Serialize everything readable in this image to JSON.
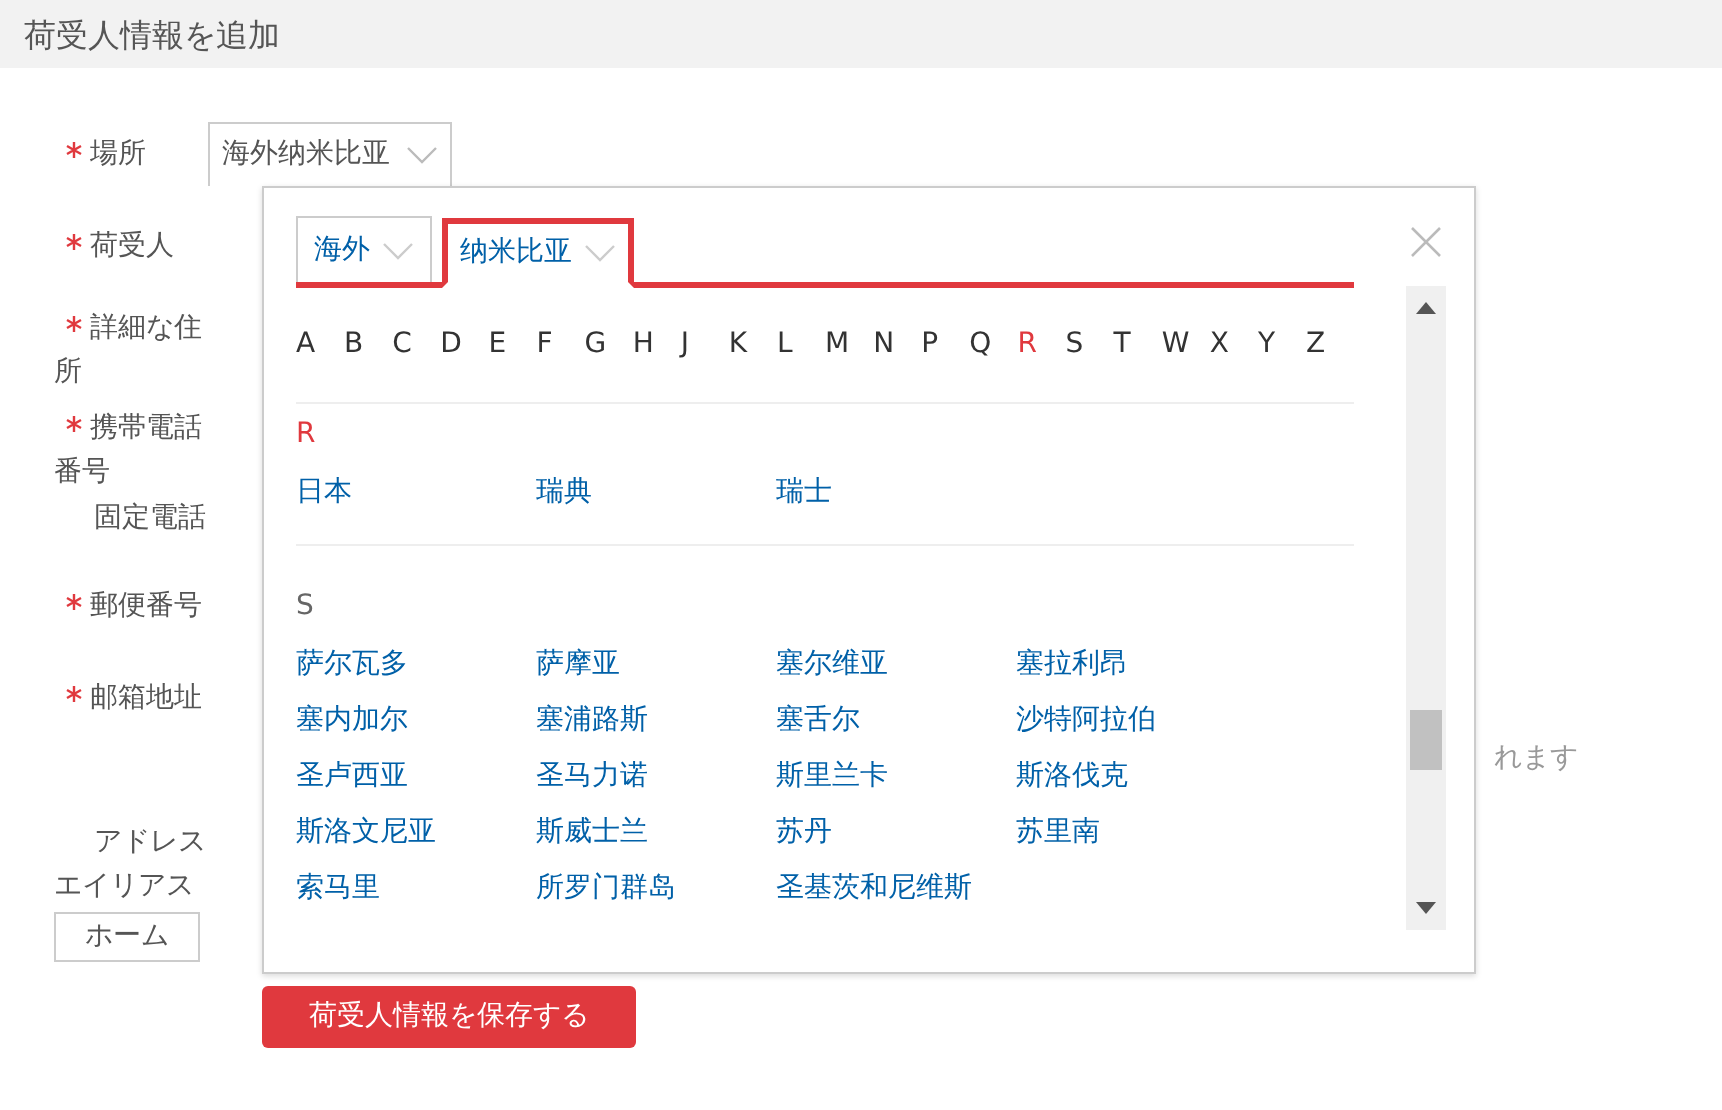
{
  "header": {
    "title": "荷受人情報を追加"
  },
  "fields": [
    {
      "label": "場所",
      "required": true,
      "kind": "select",
      "value": "海外纳米比亚"
    },
    {
      "label": "荷受人",
      "required": true,
      "kind": "text"
    },
    {
      "label": "詳細な住所",
      "required": true,
      "kind": "text"
    },
    {
      "label": "携帯電話番号",
      "required": true,
      "kind": "text"
    },
    {
      "label": "固定電話",
      "required": false,
      "kind": "text"
    },
    {
      "label": "郵便番号",
      "required": true,
      "kind": "text"
    },
    {
      "label": "邮箱地址",
      "required": true,
      "kind": "text"
    }
  ],
  "hint_text": "れます",
  "alias": {
    "label": "アドレスエイリアス",
    "buttons": [
      {
        "label": "ホーム"
      }
    ]
  },
  "save_button": "荷受人情報を保存する",
  "region_picker": {
    "tabs": [
      {
        "label": "海外",
        "selected": false
      },
      {
        "label": "纳米比亚",
        "selected": true
      }
    ],
    "letters": [
      {
        "letter": "A",
        "selected": false
      },
      {
        "letter": "B",
        "selected": false
      },
      {
        "letter": "C",
        "selected": false
      },
      {
        "letter": "D",
        "selected": false
      },
      {
        "letter": "E",
        "selected": false
      },
      {
        "letter": "F",
        "selected": false
      },
      {
        "letter": "G",
        "selected": false
      },
      {
        "letter": "H",
        "selected": false
      },
      {
        "letter": "J",
        "selected": false
      },
      {
        "letter": "K",
        "selected": false
      },
      {
        "letter": "L",
        "selected": false
      },
      {
        "letter": "M",
        "selected": false
      },
      {
        "letter": "N",
        "selected": false
      },
      {
        "letter": "P",
        "selected": false
      },
      {
        "letter": "Q",
        "selected": false
      },
      {
        "letter": "R",
        "selected": true
      },
      {
        "letter": "S",
        "selected": false
      },
      {
        "letter": "T",
        "selected": false
      },
      {
        "letter": "W",
        "selected": false
      },
      {
        "letter": "X",
        "selected": false
      },
      {
        "letter": "Y",
        "selected": false
      },
      {
        "letter": "Z",
        "selected": false
      }
    ],
    "groups": [
      {
        "letter": "R",
        "selected": true,
        "items": [
          "日本",
          "瑞典",
          "瑞士"
        ]
      },
      {
        "letter": "S",
        "selected": false,
        "items": [
          "萨尔瓦多",
          "萨摩亚",
          "塞尔维亚",
          "塞拉利昂",
          "塞内加尔",
          "塞浦路斯",
          "塞舌尔",
          "沙特阿拉伯",
          "圣卢西亚",
          "圣马力诺",
          "斯里兰卡",
          "斯洛伐克",
          "斯洛文尼亚",
          "斯威士兰",
          "苏丹",
          "苏里南",
          "索马里",
          "所罗门群岛",
          "圣基茨和尼维斯"
        ]
      }
    ]
  }
}
